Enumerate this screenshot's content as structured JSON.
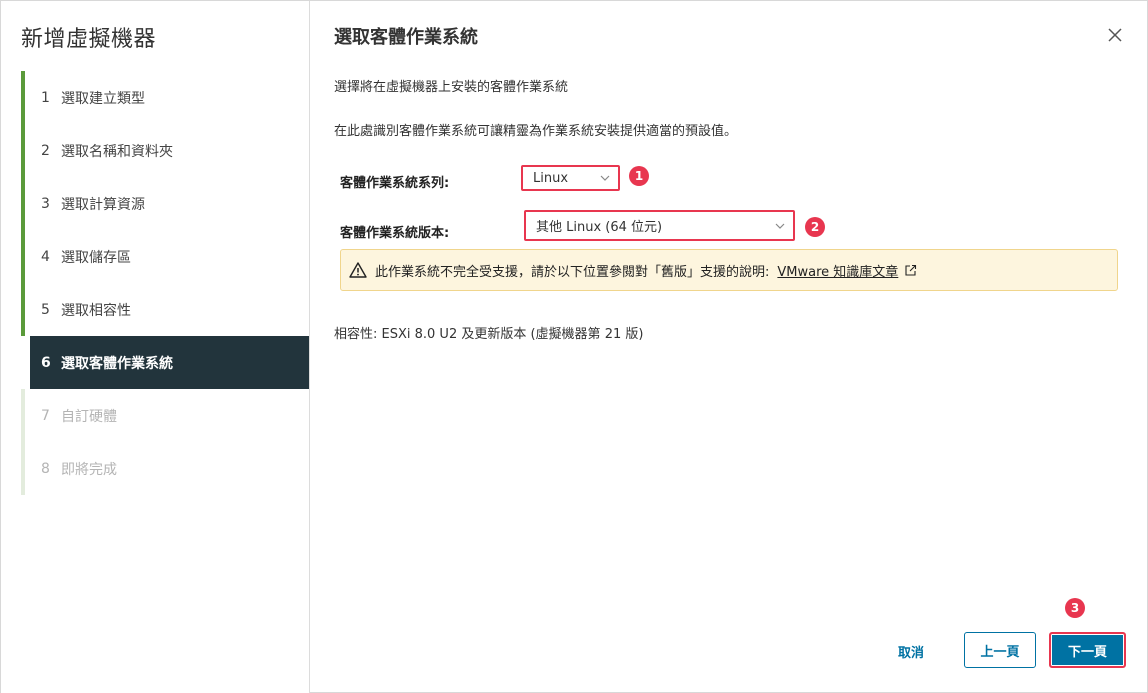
{
  "sidebar": {
    "title": "新增虛擬機器",
    "steps": [
      {
        "num": "1",
        "label": "選取建立類型"
      },
      {
        "num": "2",
        "label": "選取名稱和資料夾"
      },
      {
        "num": "3",
        "label": "選取計算資源"
      },
      {
        "num": "4",
        "label": "選取儲存區"
      },
      {
        "num": "5",
        "label": "選取相容性"
      },
      {
        "num": "6",
        "label": "選取客體作業系統"
      },
      {
        "num": "7",
        "label": "自訂硬體"
      },
      {
        "num": "8",
        "label": "即將完成"
      }
    ],
    "active_step": 6
  },
  "main": {
    "title": "選取客體作業系統",
    "intro1": "選擇將在虛擬機器上安裝的客體作業系統",
    "intro2": "在此處識別客體作業系統可讓精靈為作業系統安裝提供適當的預設值。",
    "family_label": "客體作業系統系列:",
    "family_value": "Linux",
    "version_label": "客體作業系統版本:",
    "version_value": "其他 Linux (64 位元)",
    "warning_text": "此作業系統不完全受支援，請於以下位置參閱對「舊版」支援的說明:",
    "warning_link": "VMware 知識庫文章",
    "compat_text": "相容性: ESXi 8.0 U2 及更新版本 (虛擬機器第 21 版)"
  },
  "badges": {
    "b1": "1",
    "b2": "2",
    "b3": "3"
  },
  "footer": {
    "cancel": "取消",
    "prev": "上一頁",
    "next": "下一頁"
  },
  "colors": {
    "accent": "#0072a3",
    "highlight": "#e8364f",
    "sidebar_active": "#22343c",
    "step_done": "#5a9a3a"
  }
}
